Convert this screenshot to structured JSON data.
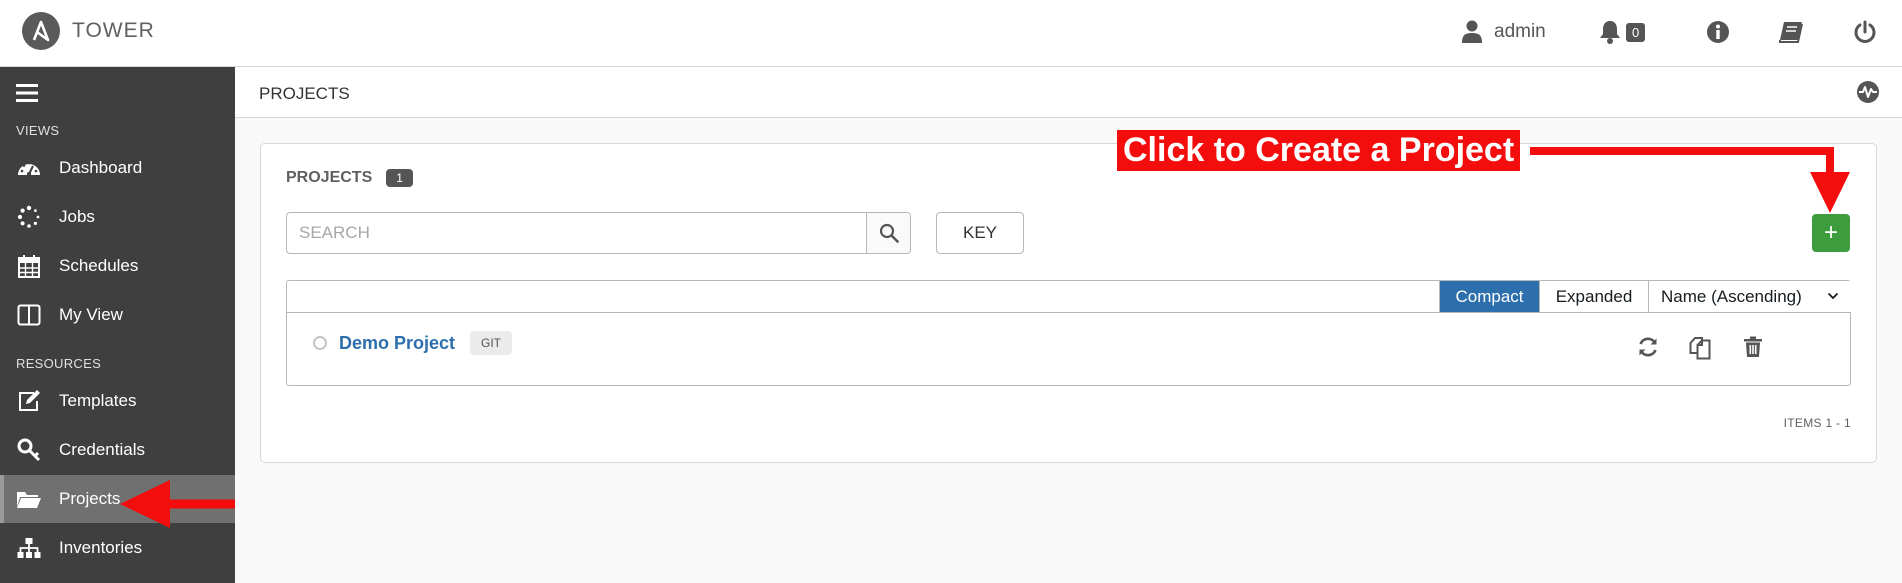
{
  "header": {
    "brand": "TOWER",
    "user": "admin",
    "notifications_count": "0",
    "icons": [
      "user-icon",
      "bell-icon",
      "info-icon",
      "docs-icon",
      "power-icon"
    ]
  },
  "sidebar": {
    "views_label": "VIEWS",
    "resources_label": "RESOURCES",
    "views": [
      {
        "label": "Dashboard",
        "icon": "dashboard-icon"
      },
      {
        "label": "Jobs",
        "icon": "jobs-icon"
      },
      {
        "label": "Schedules",
        "icon": "calendar-icon"
      },
      {
        "label": "My View",
        "icon": "columns-icon"
      }
    ],
    "resources": [
      {
        "label": "Templates",
        "icon": "edit-icon"
      },
      {
        "label": "Credentials",
        "icon": "key-icon"
      },
      {
        "label": "Projects",
        "icon": "folder-open-icon",
        "active": true
      },
      {
        "label": "Inventories",
        "icon": "sitemap-icon"
      }
    ]
  },
  "page": {
    "title": "PROJECTS"
  },
  "panel": {
    "title": "PROJECTS",
    "count": "1",
    "search_placeholder": "SEARCH",
    "key_label": "KEY",
    "add_label": "+",
    "view_modes": [
      "Compact",
      "Expanded"
    ],
    "active_view": "Compact",
    "sort_label": "Name (Ascending)",
    "items_label": "ITEMS  1 - 1"
  },
  "projects": [
    {
      "name": "Demo Project",
      "scm": "GIT"
    }
  ],
  "annotation": {
    "label": "Click to Create a Project",
    "color": "#f40d0d"
  },
  "colors": {
    "sidebar_bg": "#3f3f3f",
    "active_item_bg": "#707070",
    "primary_blue": "#2c6fac",
    "success_green": "#3d9c3d"
  }
}
